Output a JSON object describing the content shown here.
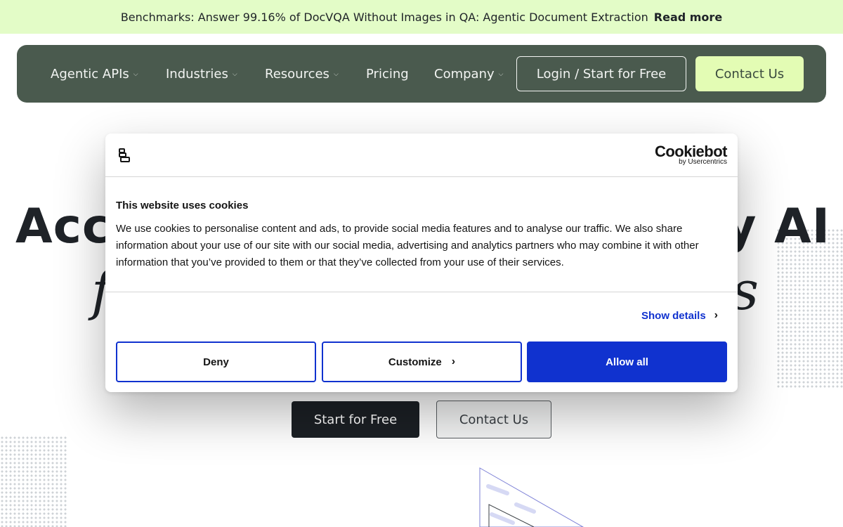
{
  "announcement": {
    "text": "Benchmarks: Answer 99.16% of DocVQA Without Images in QA: Agentic Document Extraction",
    "link": "Read more"
  },
  "nav": {
    "items": [
      {
        "label": "Agentic APIs",
        "dropdown": true
      },
      {
        "label": "Industries",
        "dropdown": true
      },
      {
        "label": "Resources",
        "dropdown": true
      },
      {
        "label": "Pricing",
        "dropdown": false
      },
      {
        "label": "Company",
        "dropdown": true
      }
    ],
    "login": "Login / Start for Free",
    "contact": "Contact Us"
  },
  "hero": {
    "title_left": "Acc",
    "title_right": "y AI",
    "subtitle_left": "f",
    "subtitle_right": "s",
    "start_button": "Start for Free",
    "contact_button": "Contact Us"
  },
  "cookie": {
    "brand": "Cookiebot",
    "brand_sub": "by Usercentrics",
    "title": "This website uses cookies",
    "body": "We use cookies to personalise content and ads, to provide social media features and to analyse our traffic. We also share information about your use of our site with our social media, advertising and analytics partners who may combine it with other information that you’ve provided to them or that they’ve collected from your use of their services.",
    "show_details": "Show details",
    "deny": "Deny",
    "customize": "Customize",
    "allow_all": "Allow all"
  },
  "colors": {
    "announcement_bg": "#e3fcc7",
    "nav_bg": "#4a5a4e",
    "nav_cta_bg": "#e3fcb4",
    "cookie_accent": "#1032cf",
    "hero_button_bg": "#1c2025"
  }
}
